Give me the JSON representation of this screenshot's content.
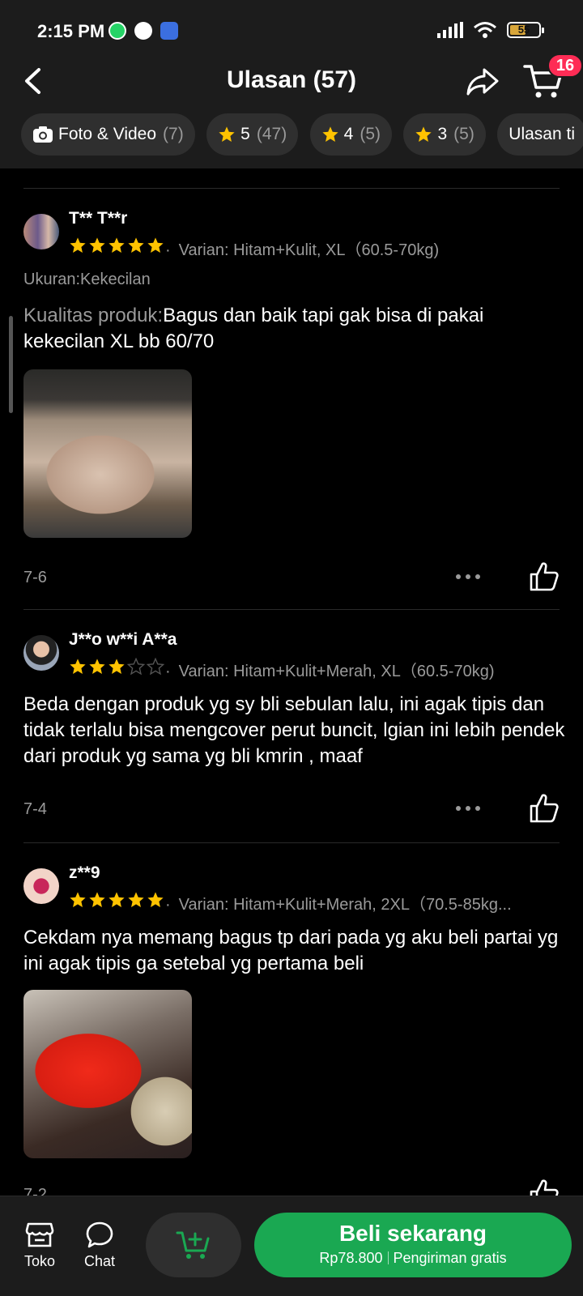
{
  "status_bar": {
    "time": "2:15 PM",
    "battery": "55",
    "icons": [
      "whatsapp-icon",
      "app-icon",
      "app-icon",
      "signal-icon",
      "wifi-icon",
      "battery-icon"
    ]
  },
  "header": {
    "title": "Ulasan (57)",
    "cart_badge": "16"
  },
  "filters": [
    {
      "label": "Foto & Video",
      "count": "(7)",
      "icon": "camera-icon"
    },
    {
      "label": "5",
      "count": "(47)",
      "icon": "star-icon"
    },
    {
      "label": "4",
      "count": "(5)",
      "icon": "star-icon"
    },
    {
      "label": "3",
      "count": "(5)",
      "icon": "star-icon"
    },
    {
      "label": "Ulasan ti",
      "count": "",
      "icon": ""
    }
  ],
  "reviews": [
    {
      "user": "T** T**r",
      "rating": 5,
      "variant": "Varian: Hitam+Kulit, XL（60.5-70kg)",
      "size_note": "Ukuran:Kekecilan",
      "quality_label": "Kualitas produk:",
      "text": "Bagus dan baik tapi gak bisa di pakai kekecilan XL bb 60/70",
      "date": "7-6"
    },
    {
      "user": "J**o w**i A**a",
      "rating": 3,
      "variant": "Varian: Hitam+Kulit+Merah, XL（60.5-70kg)",
      "text": "Beda dengan produk yg sy bli sebulan lalu, ini agak tipis dan tidak  terlalu bisa mengcover perut buncit, lgian ini lebih pendek dari produk yg sama yg bli kmrin , maaf",
      "date": "7-4"
    },
    {
      "user": "z**9",
      "rating": 5,
      "variant": "Varian: Hitam+Kulit+Merah, 2XL（70.5-85kg...",
      "text": "Cekdam nya memang bagus tp dari pada yg aku beli partai yg ini agak tipis ga setebal yg pertama beli",
      "date": "7-2"
    }
  ],
  "bottom_bar": {
    "shop_label": "Toko",
    "chat_label": "Chat",
    "buy_label": "Beli sekarang",
    "price": "Rp78.800",
    "shipping": "Pengiriman gratis"
  },
  "colors": {
    "background": "#000000",
    "bar": "#1c1c1c",
    "star": "#ffc300",
    "buy_button": "#1aa852",
    "badge": "#fe2c55",
    "muted_text": "#9a9a9a"
  }
}
